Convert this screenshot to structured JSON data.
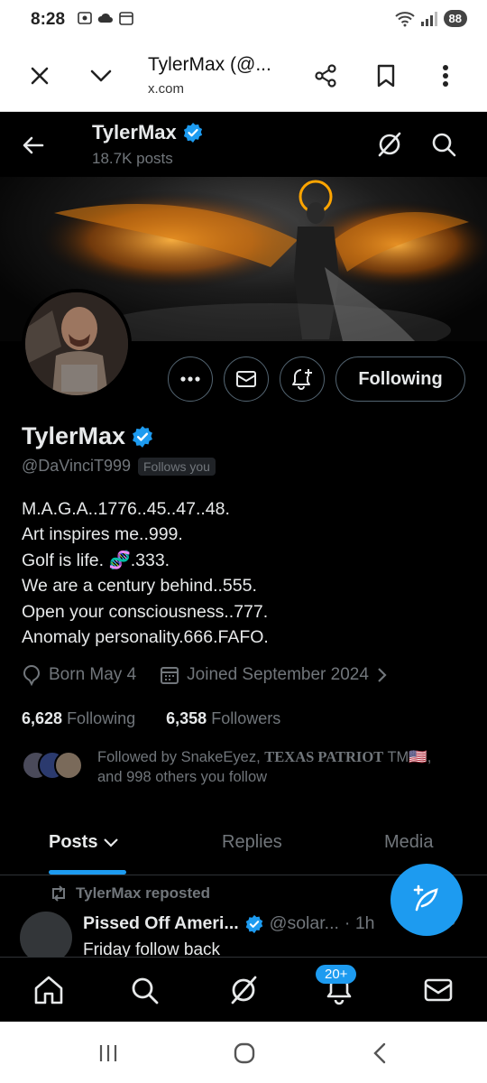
{
  "status_bar": {
    "time": "8:28",
    "battery": "88"
  },
  "custom_tab": {
    "title": "TylerMax (@...",
    "url": "x.com"
  },
  "header": {
    "name": "TylerMax",
    "posts_count": "18.7K posts"
  },
  "profile": {
    "name": "TylerMax",
    "handle": "@DaVinciT999",
    "follows_you": "Follows you",
    "following_button": "Following",
    "bio": [
      "M.A.G.A..1776..45..47..48.",
      "Art inspires me..999.",
      "Golf is life. 🧬.333.",
      "We are a century behind..555.",
      "Open your consciousness..777.",
      "Anomaly personality.666.FAFO."
    ],
    "born": "Born May 4",
    "joined": "Joined September 2024",
    "following_count": "6,628",
    "following_label": "Following",
    "followers_count": "6,358",
    "followers_label": "Followers",
    "followed_by_prefix": "Followed by SnakeEyez,",
    "followed_by_serif": "TEXAS PATRIOT",
    "followed_by_tm": " TM🇺🇸,",
    "followed_by_suffix": "and 998 others you follow"
  },
  "tabs": {
    "posts": "Posts",
    "replies": "Replies",
    "media": "Media"
  },
  "post": {
    "repost_label": "TylerMax reposted",
    "author": "Pissed Off Ameri...",
    "handle": "@solar...",
    "time": "· 1h",
    "body": "Friday follow back"
  },
  "notifications_badge": "20+",
  "colors": {
    "accent": "#1d9bf0",
    "background": "#000000",
    "text": "#e7e9ea",
    "muted": "#71767b"
  },
  "icons": [
    "close-icon",
    "chevron-down-icon",
    "share-icon",
    "bookmark-icon",
    "more-vert-icon",
    "back-arrow-icon",
    "grok-icon",
    "search-icon",
    "more-horiz-icon",
    "mail-icon",
    "bell-plus-icon",
    "verified-icon",
    "location-icon",
    "calendar-icon",
    "chevron-right-icon",
    "caret-down-icon",
    "repost-icon",
    "compose-icon",
    "home-icon",
    "bell-icon"
  ]
}
